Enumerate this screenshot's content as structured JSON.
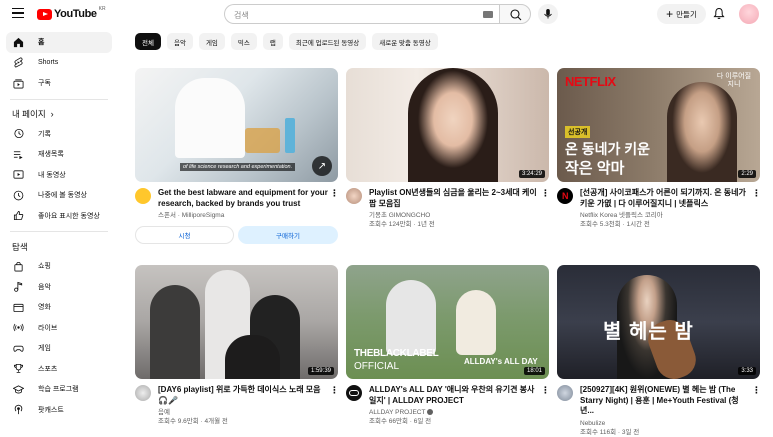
{
  "header": {
    "logo_text": "YouTube",
    "country_code": "KR",
    "search_placeholder": "검색",
    "create_label": "만들기"
  },
  "sidebar": {
    "main": [
      {
        "label": "홈",
        "icon": "home-icon"
      },
      {
        "label": "Shorts",
        "icon": "shorts-icon"
      },
      {
        "label": "구독",
        "icon": "subscriptions-icon"
      }
    ],
    "you_header": "내 페이지",
    "you_items": [
      {
        "label": "기록",
        "icon": "history-icon"
      },
      {
        "label": "재생목록",
        "icon": "playlists-icon"
      },
      {
        "label": "내 동영상",
        "icon": "your-videos-icon"
      },
      {
        "label": "나중에 볼 동영상",
        "icon": "watch-later-icon"
      },
      {
        "label": "좋아요 표시한 동영상",
        "icon": "liked-icon"
      }
    ],
    "explore_header": "탐색",
    "explore_items": [
      {
        "label": "쇼핑",
        "icon": "shopping-icon"
      },
      {
        "label": "음악",
        "icon": "music-icon"
      },
      {
        "label": "영화",
        "icon": "movies-icon"
      },
      {
        "label": "라이브",
        "icon": "live-icon"
      },
      {
        "label": "게임",
        "icon": "gaming-icon"
      },
      {
        "label": "스포츠",
        "icon": "sports-icon"
      },
      {
        "label": "학습 프로그램",
        "icon": "learning-icon"
      },
      {
        "label": "팟캐스트",
        "icon": "podcasts-icon"
      }
    ]
  },
  "chips": [
    "전체",
    "음악",
    "게임",
    "믹스",
    "랩",
    "최근에 업로드된 동영상",
    "새로운 맞춤 동영상"
  ],
  "videos": [
    {
      "title": "Get the best labware and equipment for your research, backed by brands you trust",
      "channel": "스폰서 · MilliporeSigma",
      "stats": "",
      "duration": "",
      "caption": "of life science research and experimentation.",
      "ad_buttons": [
        "시청",
        "구매하기"
      ]
    },
    {
      "title": "Playlist ON년생들의 심금을 울리는 2~3세대 케이팝 모음집",
      "channel": "기몽초 GIMONGCHO",
      "stats": "조회수 124만회 · 1년 전",
      "duration": "3:24:29"
    },
    {
      "title": "[선공개] 사이코패스가 어른이 되기까지. 온 동네가 키운 가엾 | 다 이루어질지니 | 넷플릭스",
      "channel": "Netflix Korea 넷플릭스 코리아",
      "stats": "조회수 5.3천회 · 1시간 전",
      "duration": "2:29",
      "overlay": {
        "brand": "NETFLIX",
        "badge": "선공개",
        "line1": "온 동네가 키운",
        "line2": "작은 악마",
        "corner": "다 이루어질 지니"
      }
    },
    {
      "title": "[DAY6 playlist] 위로 가득한 데이식스 노래 모음 🎧🎤",
      "channel": "음예",
      "stats": "조회수 9.6만회 · 4개월 전",
      "duration": "1:59:39"
    },
    {
      "title": "ALLDAY's ALL DAY '애니와 우찬의 유기견 봉사일지' | ALLDAY PROJECT",
      "channel": "ALLDAY PROJECT",
      "stats": "조회수 66만회 · 6일 전",
      "duration": "18:01",
      "overlay": {
        "line1": "THEBLACKLABEL",
        "line2": "OFFICIAL",
        "brand": "ALLDAY's ALL DAY"
      }
    },
    {
      "title": "[250927][4K] 원위(ONEWE) 별 헤는 밤 (The Starry Night) | 용훈 | Me+Youth Festival (청년...",
      "channel": "Nebulize",
      "stats": "조회수 116회 · 3일 전",
      "duration": "3:33",
      "overlay": {
        "line1": "별 헤는 밤"
      }
    }
  ],
  "colors": {
    "brand": "#ff0000",
    "link": "#065fd4",
    "text": "#0f0f0f",
    "muted": "#606060"
  }
}
